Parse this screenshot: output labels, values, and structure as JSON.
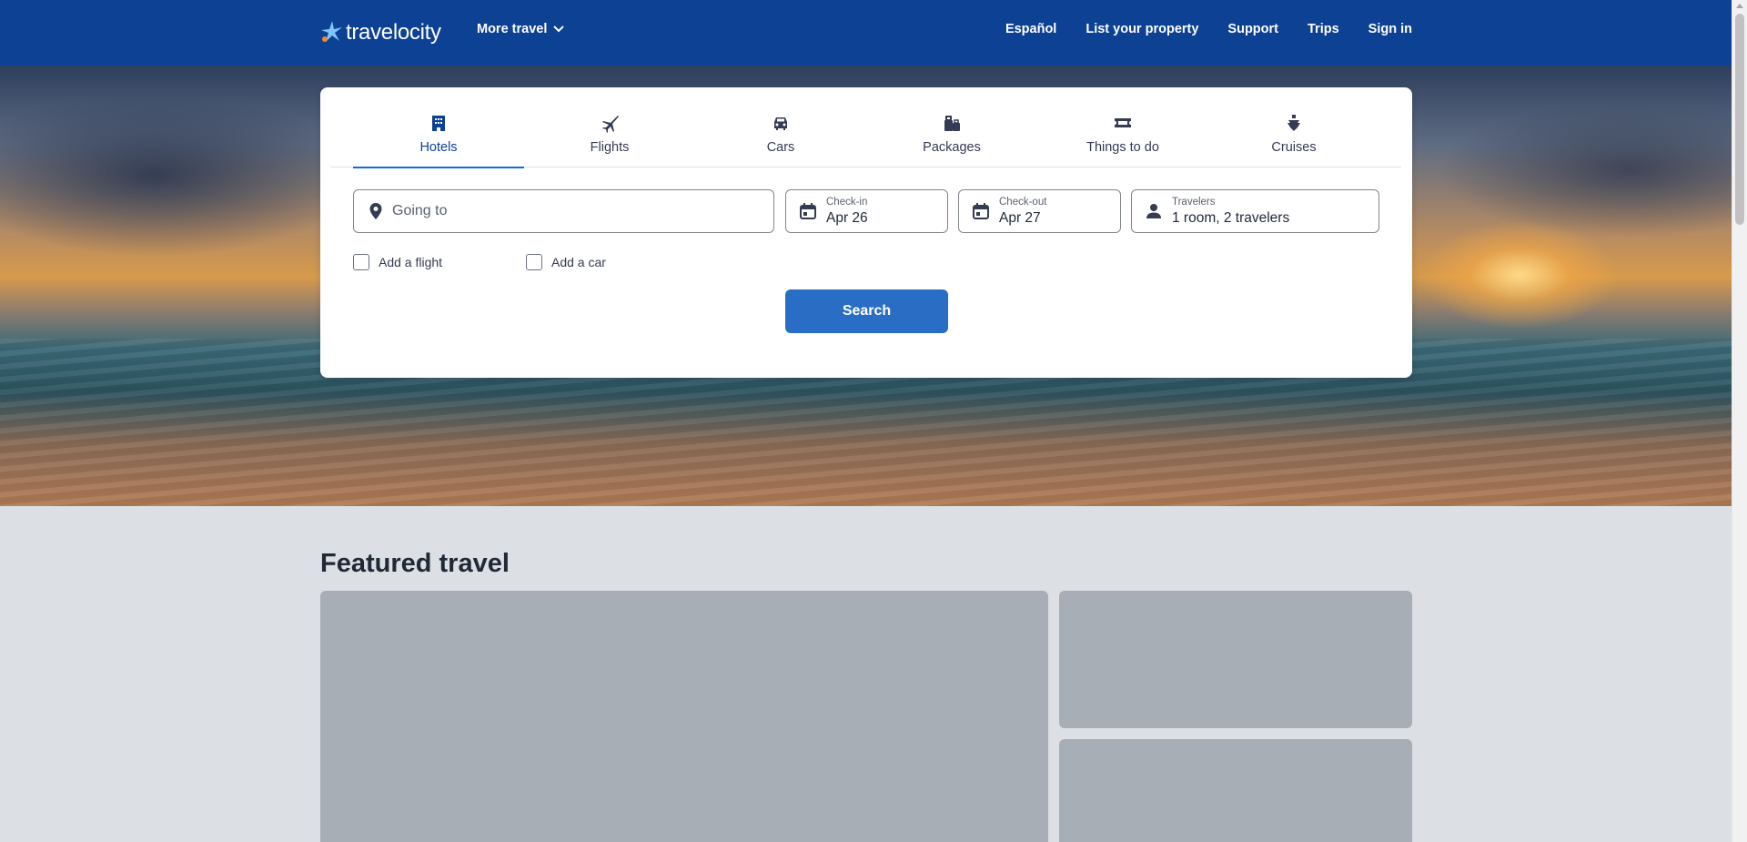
{
  "header": {
    "logo_text": "travelocity",
    "more_travel_label": "More travel",
    "nav": [
      "Español",
      "List your property",
      "Support",
      "Trips",
      "Sign in"
    ],
    "bg_color": "#0d4194"
  },
  "search_card": {
    "tabs": [
      {
        "label": "Hotels",
        "icon": "hotel-icon",
        "active": true
      },
      {
        "label": "Flights",
        "icon": "plane-icon",
        "active": false
      },
      {
        "label": "Cars",
        "icon": "car-icon",
        "active": false
      },
      {
        "label": "Packages",
        "icon": "suitcase-icon",
        "active": false
      },
      {
        "label": "Things to do",
        "icon": "ticket-icon",
        "active": false
      },
      {
        "label": "Cruises",
        "icon": "cruise-icon",
        "active": false
      }
    ],
    "going_to_placeholder": "Going to",
    "checkin": {
      "label": "Check-in",
      "value": "Apr 26"
    },
    "checkout": {
      "label": "Check-out",
      "value": "Apr 27"
    },
    "travelers": {
      "label": "Travelers",
      "value": "1 room, 2 travelers"
    },
    "add_flight_label": "Add a flight",
    "add_car_label": "Add a car",
    "search_label": "Search",
    "accent_color": "#1668e3"
  },
  "featured": {
    "title": "Featured travel"
  }
}
